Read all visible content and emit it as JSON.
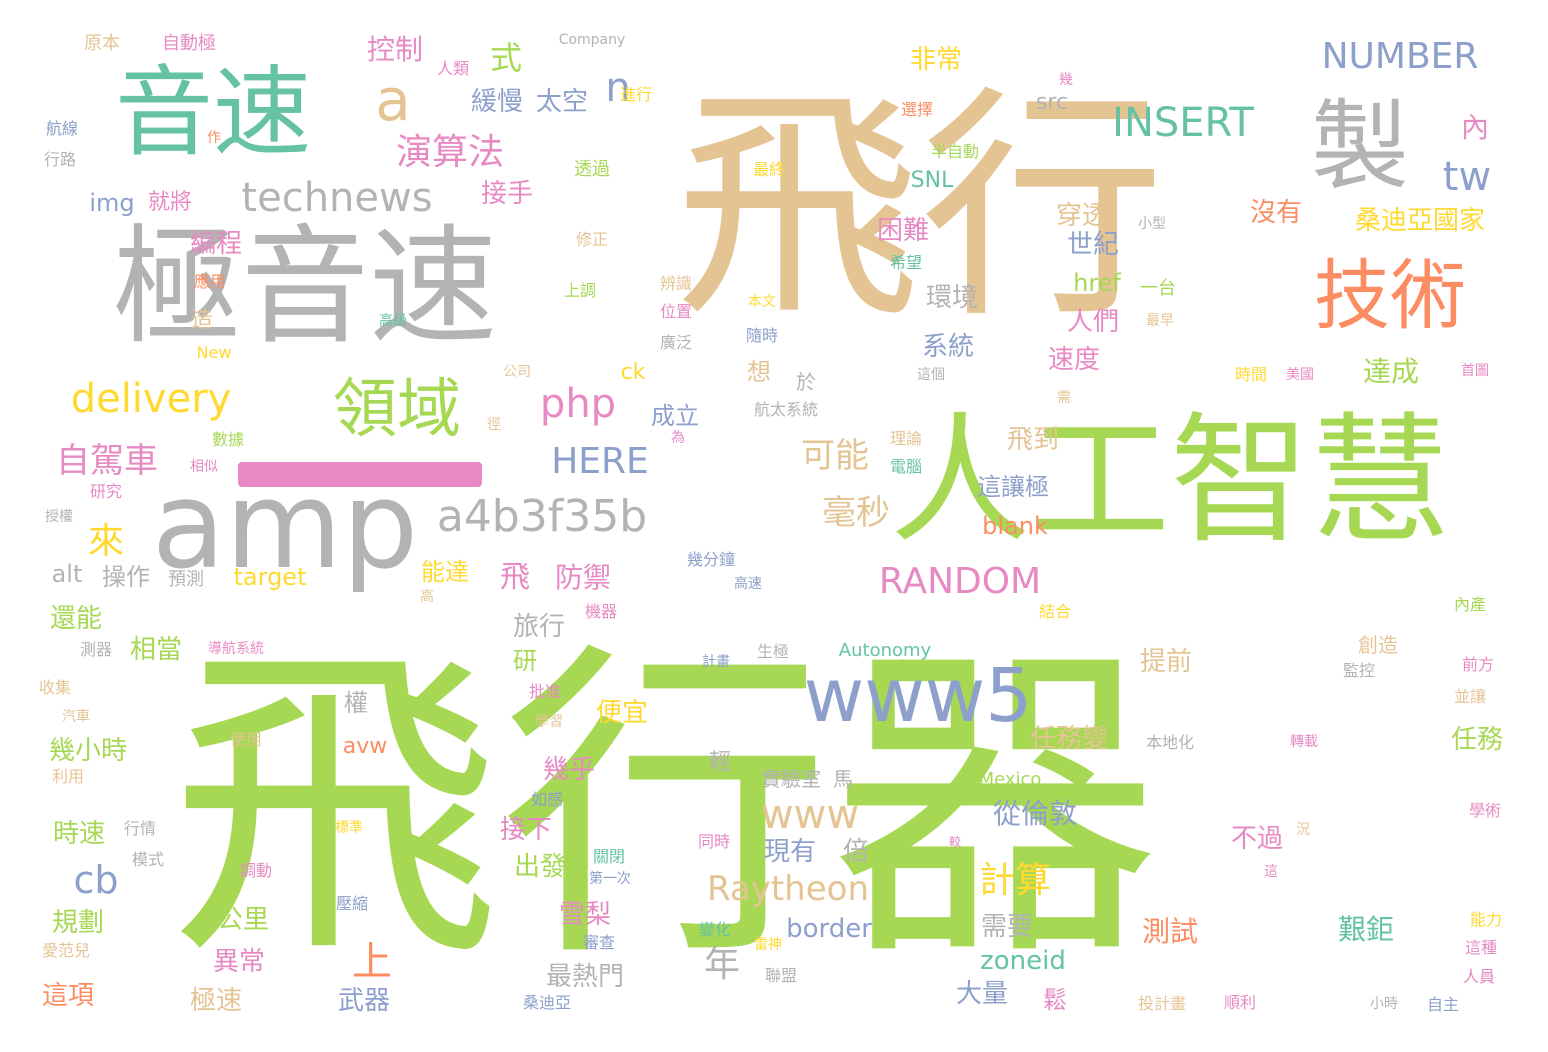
{
  "wordcloud": {
    "colors": {
      "green": "#a6d854",
      "tan": "#e5c494",
      "gray": "#b3b3b3",
      "orange": "#fc8d62",
      "teal": "#66c2a5",
      "blue": "#8da0cb",
      "pink": "#e78ac3",
      "yellow": "#ffd92f"
    },
    "words": {
      "w1": "飛行器",
      "w2": "飛行",
      "w3": "人工智慧",
      "w4": "極音速",
      "w5": "音速",
      "w6": "amp",
      "w7": "技術",
      "w8": "製",
      "w9": "www5",
      "w10": "領域",
      "w11": "a4b3f35b",
      "w12": "technews",
      "w13": "delivery",
      "w14": "php",
      "w15": "INSERT",
      "w16": "NUMBER",
      "w17": "RANDOM",
      "w18": "HERE",
      "w19": "Raytheon",
      "w20": "www",
      "w21": "a",
      "w22": "tw",
      "w23": "n",
      "w24": "cb",
      "w25": "演算法",
      "w26": "自駕車",
      "w27": "可能",
      "w28": "毫秒",
      "w29": "計算",
      "w30": "年",
      "w31": "上",
      "w32": "來",
      "w33": "飛",
      "w34": "防禦",
      "w35": "控制",
      "w36": "式",
      "w37": "緩慢",
      "w38": "太空",
      "w39": "接手",
      "w40": "img",
      "w41": "就將",
      "w42": "編程",
      "w43": "困難",
      "w44": "環境",
      "w45": "系統",
      "w46": "世紀",
      "w47": "人們",
      "w48": "速度",
      "w49": "達成",
      "w50": "穿透",
      "w51": "沒有",
      "w52": "桑迪亞國家",
      "w53": "非常",
      "w54": "內",
      "w55": "src",
      "w56": "SNL",
      "w57": "href",
      "w58": "一台",
      "w59": "造",
      "w60": "想",
      "w61": "於",
      "w62": "成立",
      "w63": "飛到",
      "w64": "這讓極",
      "w65": "blank",
      "w66": "能達",
      "w67": "target",
      "w68": "alt",
      "w69": "操作",
      "w70": "預測",
      "w71": "還能",
      "w72": "相當",
      "w73": "研",
      "w74": "旅行",
      "w75": "提前",
      "w76": "創造",
      "w77": "權",
      "w78": "便宜",
      "w79": "幾小時",
      "w80": "avw",
      "w81": "任務變",
      "w82": "任務",
      "w83": "幾乎",
      "w84": "輕",
      "w85": "實驗室",
      "w86": "馬",
      "w87": "從倫敦",
      "w88": "時速",
      "w89": "接下",
      "w90": "不過",
      "w91": "現有",
      "w92": "倍",
      "w93": "出發",
      "w94": "規劃",
      "w95": "公里",
      "w96": "雪梨",
      "w97": "border",
      "w98": "需要",
      "w99": "測試",
      "w100": "艱鉅",
      "w101": "異常",
      "w102": "最熱門",
      "w103": "zoneid",
      "w104": "這項",
      "w105": "極速",
      "w106": "武器",
      "w107": "大量",
      "w108": "鬆",
      "w109": "原本",
      "w110": "自動極",
      "w111": "Company",
      "w112": "人類",
      "w113": "進行",
      "w114": "航線",
      "w115": "行路",
      "w116": "作",
      "w117": "幾",
      "w118": "選擇",
      "w119": "透過",
      "w120": "最終",
      "w121": "半自動",
      "w122": "小型",
      "w123": "修正",
      "w124": "應用",
      "w125": "上調",
      "w126": "辨識",
      "w127": "位置",
      "w128": "本文",
      "w129": "希望",
      "w130": "高級",
      "w131": "最早",
      "w132": "New",
      "w133": "公司",
      "w134": "ck",
      "w135": "廣泛",
      "w136": "隨時",
      "w137": "這個",
      "w138": "時間",
      "w139": "美國",
      "w140": "首圖",
      "w141": "需",
      "w142": "徑",
      "w143": "為",
      "w144": "航太系統",
      "w145": "理論",
      "w146": "電腦",
      "w147": "數據",
      "w148": "相似",
      "w149": "研究",
      "w150": "授權",
      "w151": "幾分鐘",
      "w152": "高速",
      "w153": "高",
      "w154": "機器",
      "w155": "結合",
      "w156": "內產",
      "w157": "導航系統",
      "w158": "測器",
      "w159": "Autonomy",
      "w160": "計畫",
      "w161": "生極",
      "w162": "監控",
      "w163": "前方",
      "w164": "收集",
      "w165": "汽車",
      "w166": "批准",
      "w167": "學習",
      "w168": "並讓",
      "w169": "使用",
      "w170": "本地化",
      "w171": "轉載",
      "w172": "利用",
      "w173": "Mexico",
      "w174": "如感",
      "w175": "學術",
      "w176": "行情",
      "w177": "標準",
      "w178": "同時",
      "w179": "況",
      "w180": "模式",
      "w181": "關閉",
      "w182": "調動",
      "w183": "第一次",
      "w184": "這",
      "w185": "壓縮",
      "w186": "變化",
      "w187": "能力",
      "w188": "審查",
      "w189": "雷神",
      "w190": "這種",
      "w191": "愛范兒",
      "w192": "聯盟",
      "w193": "人員",
      "w194": "桑迪亞",
      "w195": "投計畫",
      "w196": "順利",
      "w197": "小時",
      "w198": "自主",
      "w199": "較"
    }
  }
}
